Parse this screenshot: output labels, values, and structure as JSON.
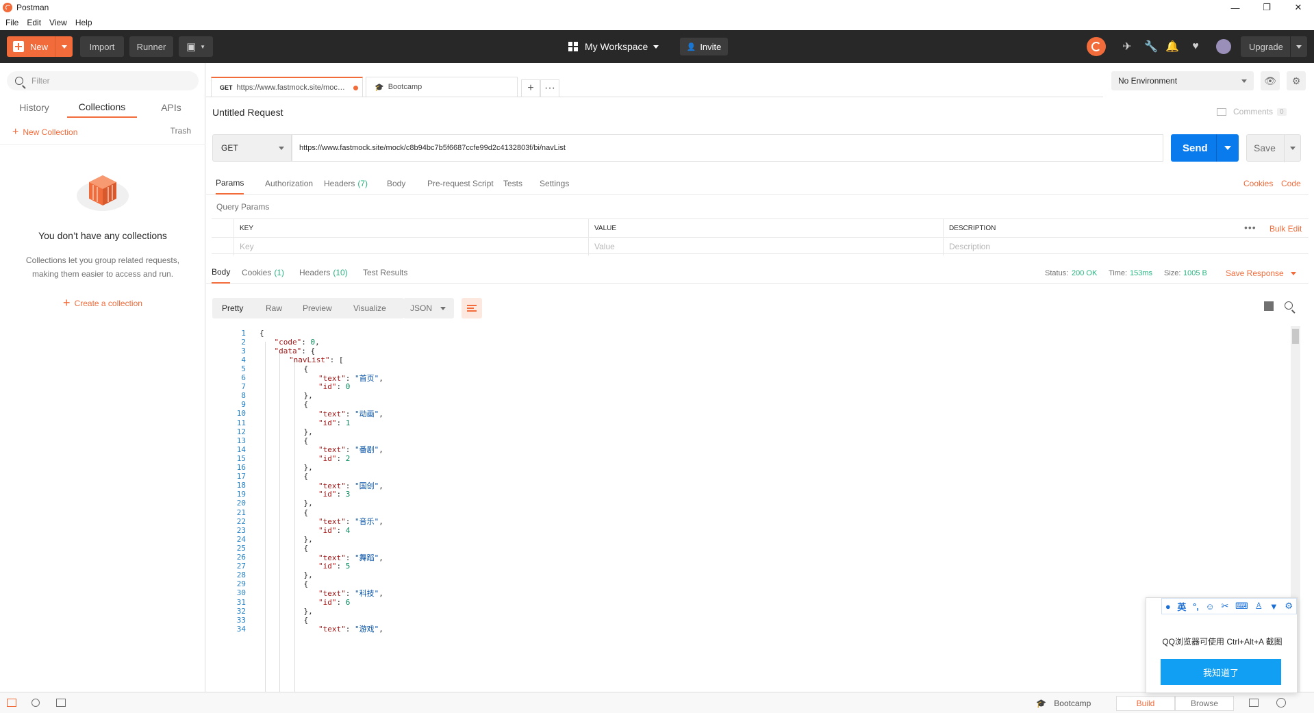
{
  "window": {
    "title": "Postman",
    "controls": [
      "—",
      "❐",
      "✕"
    ]
  },
  "menu": [
    "File",
    "Edit",
    "View",
    "Help"
  ],
  "header": {
    "new_label": "New",
    "import_label": "Import",
    "runner_label": "Runner",
    "workspace_label": "My Workspace",
    "invite_label": "Invite",
    "upgrade_label": "Upgrade"
  },
  "sidebar": {
    "filter_placeholder": "Filter",
    "tabs": [
      "History",
      "Collections",
      "APIs"
    ],
    "active_tab": "Collections",
    "new_collection": "New Collection",
    "trash": "Trash",
    "empty_title": "You don’t have any collections",
    "empty_desc": "Collections let you group related requests, making them easier to access and run.",
    "create_label": "Create a collection"
  },
  "tabs": [
    {
      "method": "GET",
      "label": "https://www.fastmock.site/moc…",
      "active": true,
      "unsaved": true
    },
    {
      "method": "",
      "label": "Bootcamp",
      "active": false
    }
  ],
  "environment": {
    "selected": "No Environment"
  },
  "request": {
    "title": "Untitled Request",
    "comments_label": "Comments",
    "comments_count": "0",
    "method": "GET",
    "url": "https://www.fastmock.site/mock/c8b94bc7b5f6687ccfe99d2c4132803f/bi/navList",
    "send_label": "Send",
    "save_label": "Save"
  },
  "param_tabs": {
    "params": "Params",
    "authorization": "Authorization",
    "headers": "Headers",
    "headers_count": "(7)",
    "body": "Body",
    "prerequest": "Pre-request Script",
    "tests": "Tests",
    "settings": "Settings",
    "cookies": "Cookies",
    "code": "Code"
  },
  "query_params": {
    "title": "Query Params",
    "columns": [
      "KEY",
      "VALUE",
      "DESCRIPTION"
    ],
    "placeholders": [
      "Key",
      "Value",
      "Description"
    ],
    "bulk_edit": "Bulk Edit"
  },
  "response_tabs": {
    "body": "Body",
    "cookies": "Cookies",
    "cookies_count": "(1)",
    "headers": "Headers",
    "headers_count": "(10)",
    "test_results": "Test Results"
  },
  "response_status": {
    "status_label": "Status:",
    "status_value": "200 OK",
    "time_label": "Time:",
    "time_value": "153ms",
    "size_label": "Size:",
    "size_value": "1005 B",
    "save_response": "Save Response"
  },
  "view_tabs": {
    "pretty": "Pretty",
    "raw": "Raw",
    "preview": "Preview",
    "visualize": "Visualize",
    "format": "JSON"
  },
  "code_lines": [
    [
      1,
      0,
      "{"
    ],
    [
      2,
      1,
      "\"code\": 0,"
    ],
    [
      3,
      1,
      "\"data\": {"
    ],
    [
      4,
      2,
      "\"navList\": ["
    ],
    [
      5,
      3,
      "{"
    ],
    [
      6,
      4,
      "\"text\": \"首页\","
    ],
    [
      7,
      4,
      "\"id\": 0"
    ],
    [
      8,
      3,
      "},"
    ],
    [
      9,
      3,
      "{"
    ],
    [
      10,
      4,
      "\"text\": \"动画\","
    ],
    [
      11,
      4,
      "\"id\": 1"
    ],
    [
      12,
      3,
      "},"
    ],
    [
      13,
      3,
      "{"
    ],
    [
      14,
      4,
      "\"text\": \"番剧\","
    ],
    [
      15,
      4,
      "\"id\": 2"
    ],
    [
      16,
      3,
      "},"
    ],
    [
      17,
      3,
      "{"
    ],
    [
      18,
      4,
      "\"text\": \"国创\","
    ],
    [
      19,
      4,
      "\"id\": 3"
    ],
    [
      20,
      3,
      "},"
    ],
    [
      21,
      3,
      "{"
    ],
    [
      22,
      4,
      "\"text\": \"音乐\","
    ],
    [
      23,
      4,
      "\"id\": 4"
    ],
    [
      24,
      3,
      "},"
    ],
    [
      25,
      3,
      "{"
    ],
    [
      26,
      4,
      "\"text\": \"舞蹈\","
    ],
    [
      27,
      4,
      "\"id\": 5"
    ],
    [
      28,
      3,
      "},"
    ],
    [
      29,
      3,
      "{"
    ],
    [
      30,
      4,
      "\"text\": \"科技\","
    ],
    [
      31,
      4,
      "\"id\": 6"
    ],
    [
      32,
      3,
      "},"
    ],
    [
      33,
      3,
      "{"
    ],
    [
      34,
      4,
      "\"text\": \"游戏\","
    ]
  ],
  "statusbar": {
    "bootcamp": "Bootcamp",
    "build": "Build",
    "browse": "Browse"
  },
  "qq_popup": {
    "ime_label": "英",
    "message": "QQ浏览器可使用 Ctrl+Alt+A 截图",
    "button": "我知道了"
  },
  "colors": {
    "accent": "#f26b3a",
    "send_blue": "#097bed",
    "status_green": "#26b47f",
    "header_bg": "#282828"
  }
}
